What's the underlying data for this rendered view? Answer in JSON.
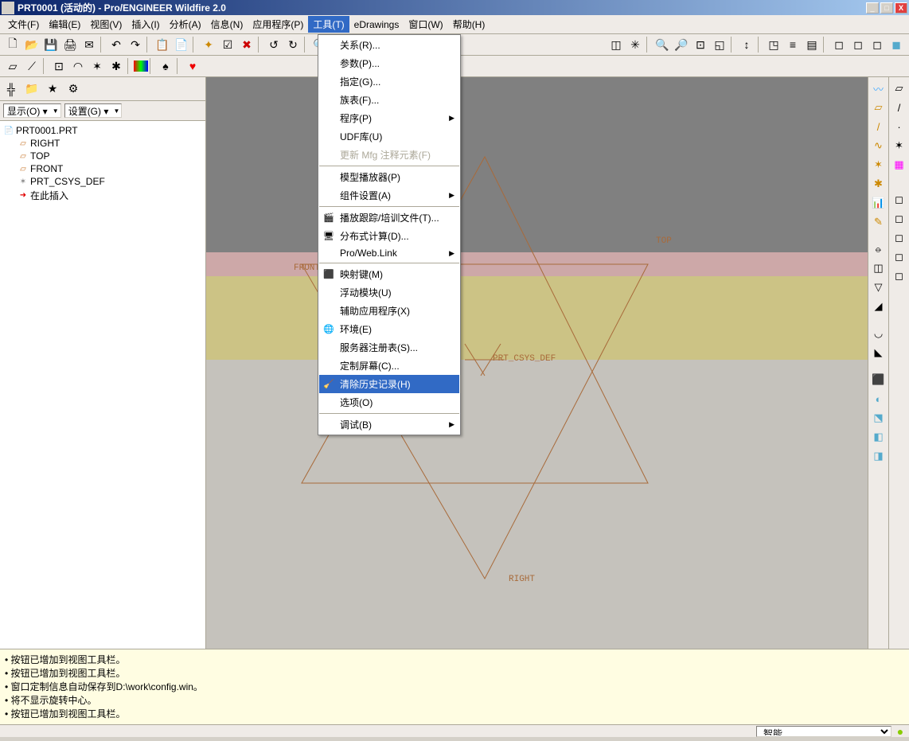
{
  "title": "PRT0001 (活动的) - Pro/ENGINEER Wildfire 2.0",
  "menus": {
    "file": "文件(F)",
    "edit": "编辑(E)",
    "view": "视图(V)",
    "insert": "插入(I)",
    "analysis": "分析(A)",
    "info": "信息(N)",
    "app": "应用程序(P)",
    "tools": "工具(T)",
    "edrawings": "eDrawings",
    "window": "窗口(W)",
    "help": "帮助(H)"
  },
  "left": {
    "show_btn": "显示(O) ▾",
    "settings_btn": "设置(G) ▾",
    "tree": {
      "root": "PRT0001.PRT",
      "items": [
        {
          "label": "RIGHT",
          "type": "datum"
        },
        {
          "label": "TOP",
          "type": "datum"
        },
        {
          "label": "FRONT",
          "type": "datum"
        },
        {
          "label": "PRT_CSYS_DEF",
          "type": "csys"
        },
        {
          "label": "在此插入",
          "type": "insert"
        }
      ]
    }
  },
  "dropdown": {
    "items": [
      {
        "label": "关系(R)..."
      },
      {
        "label": "参数(P)..."
      },
      {
        "label": "指定(G)..."
      },
      {
        "label": "族表(F)..."
      },
      {
        "label": "程序(P)",
        "arrow": true
      },
      {
        "label": "UDF库(U)"
      },
      {
        "label": "更新 Mfg 注释元素(F)",
        "disabled": true
      },
      {
        "sep": true
      },
      {
        "label": "模型播放器(P)"
      },
      {
        "label": "组件设置(A)",
        "arrow": true
      },
      {
        "sep": true
      },
      {
        "label": "播放跟踪/培训文件(T)...",
        "icon": "🎬"
      },
      {
        "label": "分布式计算(D)...",
        "icon": "🖥"
      },
      {
        "label": "Pro/Web.Link",
        "arrow": true
      },
      {
        "sep": true
      },
      {
        "label": "映射键(M)",
        "icon": "⬛"
      },
      {
        "label": "浮动模块(U)"
      },
      {
        "label": "辅助应用程序(X)"
      },
      {
        "label": "环境(E)",
        "icon": "🌐"
      },
      {
        "label": "服务器注册表(S)..."
      },
      {
        "label": "定制屏幕(C)..."
      },
      {
        "label": "清除历史记录(H)",
        "icon": "🧹",
        "highlight": true
      },
      {
        "label": "选项(O)"
      },
      {
        "sep": true
      },
      {
        "label": "调试(B)",
        "arrow": true
      }
    ]
  },
  "geom": {
    "front": "FRONT",
    "top": "TOP",
    "right": "RIGHT",
    "csys": "PRT_CSYS_DEF"
  },
  "messages": [
    "按钮已增加到视图工具栏。",
    "按钮已增加到视图工具栏。",
    "窗口定制信息自动保存到D:\\work\\config.win。",
    "将不显示旋转中心。",
    "按钮已增加到视图工具栏。"
  ],
  "status": {
    "mode": "智能"
  }
}
